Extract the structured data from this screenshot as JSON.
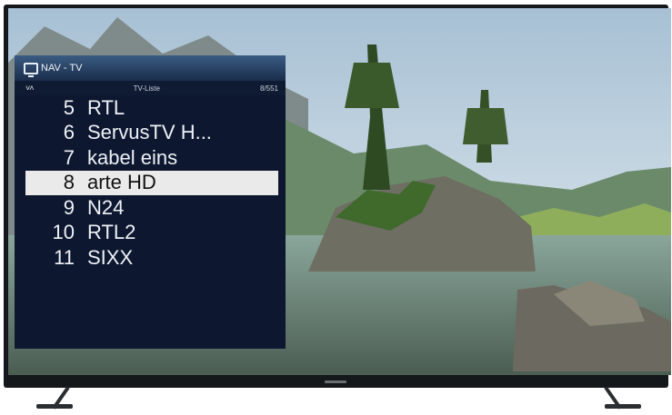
{
  "osd": {
    "title": "NAV - TV",
    "nav_arrows": "˅˄",
    "list_name": "TV-Liste",
    "position": "8/551",
    "channels": [
      {
        "num": "5",
        "name": "RTL"
      },
      {
        "num": "6",
        "name": "ServusTV H..."
      },
      {
        "num": "7",
        "name": "kabel eins"
      },
      {
        "num": "8",
        "name": "arte HD"
      },
      {
        "num": "9",
        "name": "N24"
      },
      {
        "num": "10",
        "name": "RTL2"
      },
      {
        "num": "11",
        "name": "SIXX"
      }
    ],
    "selected_num": "8"
  },
  "colors": {
    "osd_background": "#0d1830",
    "header_top": "#3a5b82",
    "header_bottom": "#1a2d4b",
    "selection": "#eaeaea"
  },
  "icons": [
    "tv-icon",
    "chevron-up-down-icon"
  ]
}
